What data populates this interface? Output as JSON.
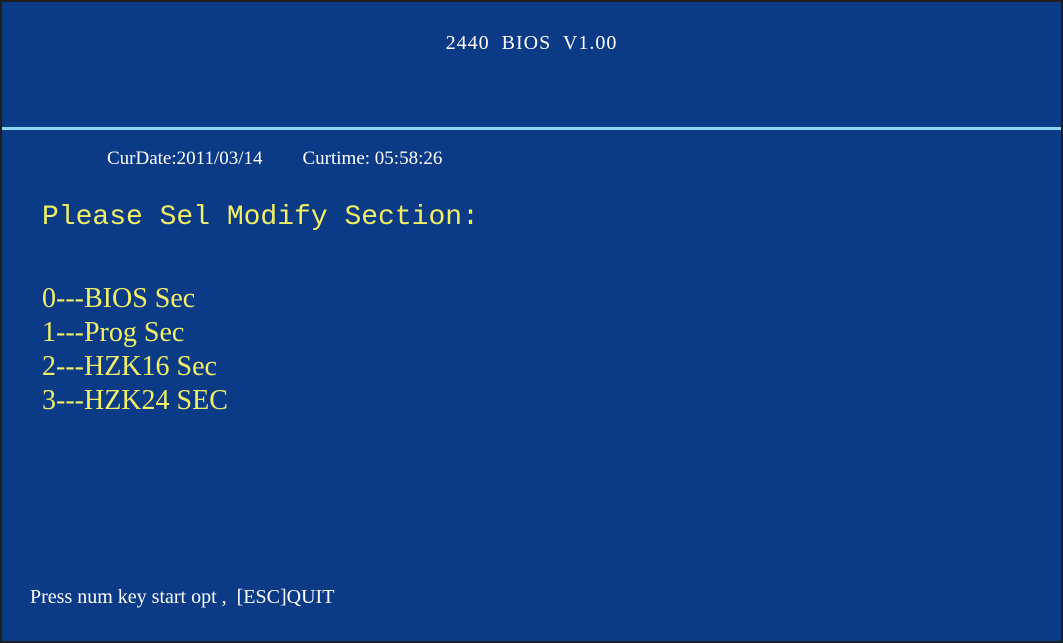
{
  "header": {
    "title": "2440  BIOS  V1.00"
  },
  "status": {
    "cur_date": "CurDate:2011/03/14",
    "cur_time": "Curtime: 05:58:26"
  },
  "main": {
    "prompt": "Please Sel Modify Section:",
    "options": [
      {
        "label": "0---BIOS Sec"
      },
      {
        "label": "1---Prog Sec"
      },
      {
        "label": "2---HZK16 Sec"
      },
      {
        "label": "3---HZK24 SEC"
      }
    ]
  },
  "footer": {
    "hint": "Press num key start opt ,  [ESC]QUIT"
  },
  "colors": {
    "background": "#0b3a86",
    "divider": "#8fd8f2",
    "text_white": "#ffffff",
    "text_yellow": "#f1f066"
  }
}
